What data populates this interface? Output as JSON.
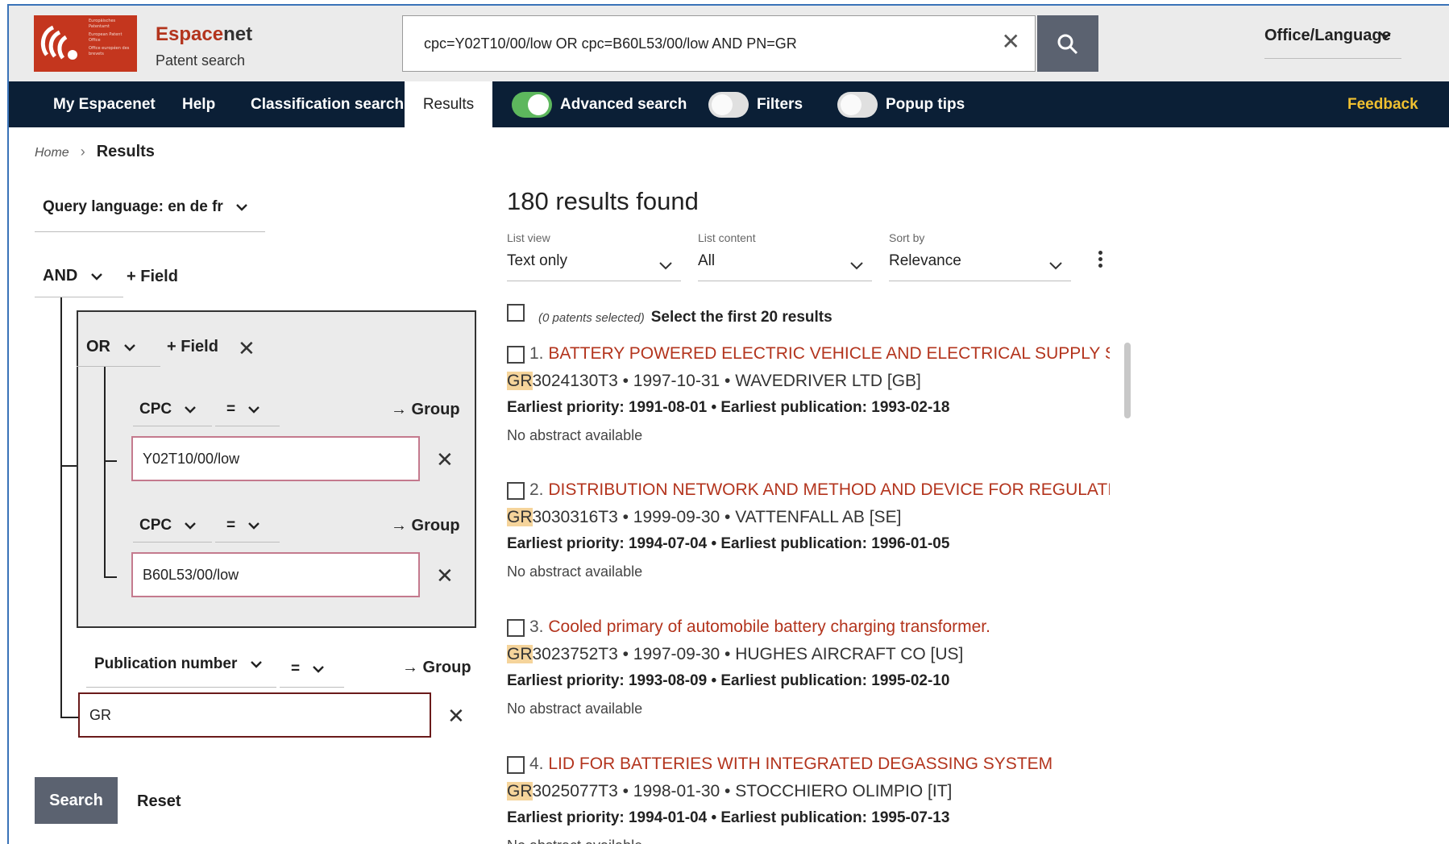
{
  "header": {
    "logo_lines": [
      "Europäisches Patentamt",
      "European Patent Office",
      "Office européen des brevets"
    ],
    "brand_a": "Espace",
    "brand_b": "net",
    "subbrand": "Patent search",
    "query": "cpc=Y02T10/00/low OR cpc=B60L53/00/low AND PN=GR",
    "office_language": "Office/Language"
  },
  "nav": {
    "my_espacenet": "My Espacenet",
    "help": "Help",
    "classification": "Classification search",
    "results": "Results",
    "advanced": "Advanced search",
    "filters": "Filters",
    "popup": "Popup tips",
    "feedback": "Feedback",
    "advanced_on": true,
    "filters_on": false,
    "popup_on": false
  },
  "breadcrumb": {
    "home": "Home",
    "current": "Results"
  },
  "query_builder": {
    "query_language": "Query language: en de fr",
    "top_operator": "AND",
    "add_field": "+ Field",
    "group_operator": "OR",
    "group_label": "→ Group",
    "clauses": [
      {
        "field": "CPC",
        "op": "=",
        "value": "Y02T10/00/low"
      },
      {
        "field": "CPC",
        "op": "=",
        "value": "B60L53/00/low"
      }
    ],
    "pub_field": "Publication number",
    "pub_op": "=",
    "pub_value": "GR",
    "search": "Search",
    "reset": "Reset"
  },
  "results": {
    "count": "180 results found",
    "list_view_label": "List view",
    "list_view": "Text only",
    "list_content_label": "List content",
    "list_content": "All",
    "sort_label": "Sort by",
    "sort": "Relevance",
    "selected": "(0 patents selected)",
    "select_first": "Select the first 20 results",
    "items": [
      {
        "num": "1.",
        "title": "BATTERY POWERED ELECTRIC VEHICLE AND ELECTRICAL SUPPLY S...",
        "cc": "GR",
        "pubno": "3024130T3 • 1997-10-31 • WAVEDRIVER LTD [GB]",
        "priority": "Earliest priority: 1991-08-01 • Earliest publication: 1993-02-18",
        "abstract": "No abstract available"
      },
      {
        "num": "2.",
        "title": "DISTRIBUTION NETWORK AND METHOD AND DEVICE FOR REGULATI...",
        "cc": "GR",
        "pubno": "3030316T3 • 1999-09-30 • VATTENFALL AB [SE]",
        "priority": "Earliest priority: 1994-07-04 • Earliest publication: 1996-01-05",
        "abstract": "No abstract available"
      },
      {
        "num": "3.",
        "title": "Cooled primary of automobile battery charging transformer.",
        "cc": "GR",
        "pubno": "3023752T3 • 1997-09-30 • HUGHES AIRCRAFT CO [US]",
        "priority": "Earliest priority: 1993-08-09 • Earliest publication: 1995-02-10",
        "abstract": "No abstract available"
      },
      {
        "num": "4.",
        "title": "LID FOR BATTERIES WITH INTEGRATED DEGASSING SYSTEM",
        "cc": "GR",
        "pubno": "3025077T3 • 1998-01-30 • STOCCHIERO OLIMPIO [IT]",
        "priority": "Earliest priority: 1994-01-04 • Earliest publication: 1995-07-13",
        "abstract": "No abstract available"
      }
    ]
  },
  "colors": {
    "brand": "#c4361e",
    "nav": "#0b1f36",
    "toggle_on": "#5db75d",
    "link": "#b3341d",
    "feedback": "#f0c030",
    "highlight": "#f5d49b"
  },
  "icons": [
    "logo-emblem",
    "clear-icon",
    "search-icon",
    "chevron-down-icon",
    "chevron-right-icon",
    "close-icon",
    "kebab-icon",
    "checkbox"
  ]
}
